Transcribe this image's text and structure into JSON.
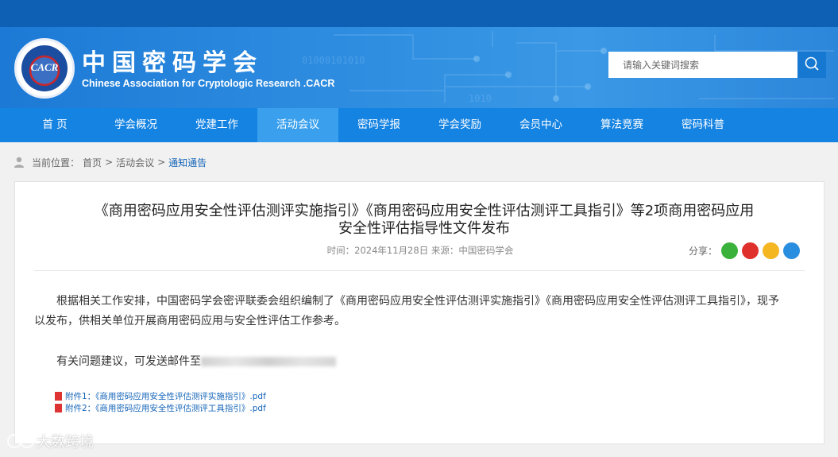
{
  "site": {
    "logo_text": "CACR",
    "title_cn": "中国密码学会",
    "title_en": "Chinese Association for Cryptologic Research .CACR"
  },
  "search": {
    "placeholder": "请输入关键词搜索"
  },
  "nav": {
    "items": [
      {
        "label": "首 页"
      },
      {
        "label": "学会概况"
      },
      {
        "label": "党建工作"
      },
      {
        "label": "活动会议"
      },
      {
        "label": "密码学报"
      },
      {
        "label": "学会奖励"
      },
      {
        "label": "会员中心"
      },
      {
        "label": "算法竞赛"
      },
      {
        "label": "密码科普"
      }
    ],
    "active_index": 3
  },
  "breadcrumb": {
    "prefix": "当前位置：",
    "items": [
      "首页",
      "活动会议",
      "通知通告"
    ],
    "separator": ">"
  },
  "article": {
    "title_line1": "《商用密码应用安全性评估测评实施指引》《商用密码应用安全性评估测评工具指引》等2项商用密码应用",
    "title_line2": "安全性评估指导性文件发布",
    "meta": "时间：2024年11月28日  来源：中国密码学会",
    "share_label": "分享：",
    "share_icons": [
      "wechat-icon",
      "weibo-icon",
      "qzone-icon",
      "qq-icon"
    ],
    "paragraph1": "根据相关工作安排，中国密码学会密评联委会组织编制了《商用密码应用安全性评估测评实施指引》《商用密码应用安全性评估测评工具指引》，现予以发布，供相关单位开展商用密码应用与安全性评估工作参考。",
    "paragraph2_prefix": "有关问题建议，可发送邮件至",
    "attachments": [
      "附件1：《商用密码应用安全性评估测评实施指引》.pdf",
      "附件2：《商用密码应用安全性评估测评工具指引》.pdf"
    ]
  },
  "watermark": "大数跨境",
  "colors": {
    "topbar": "#0d60b4",
    "nav": "#1583e2",
    "nav_active": "#3aa0ee",
    "link": "#1665b8"
  }
}
